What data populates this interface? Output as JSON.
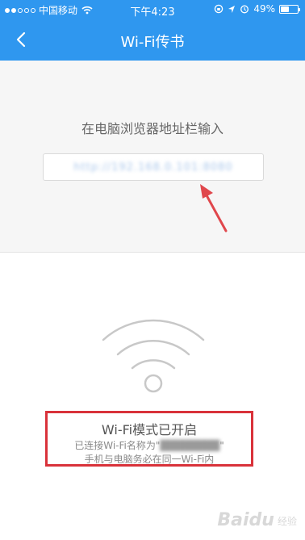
{
  "status_bar": {
    "carrier": "中国移动",
    "time": "下午4:23",
    "battery": "49%",
    "battery_level": 0.49
  },
  "nav": {
    "title": "Wi-Fi传书",
    "back_icon": "chevron-left-icon"
  },
  "instruction": "在电脑浏览器地址栏输入",
  "address": {
    "url": "http://192.168.0.101:8080"
  },
  "wifi_status": {
    "title": "Wi-Fi模式已开启",
    "line1_prefix": "已连接Wi-Fi名称为\"",
    "ssid": "████████",
    "line1_suffix": "\"",
    "line2": "手机与电脑务必在同一Wi-Fi内"
  },
  "watermark": {
    "logo": "Baidu",
    "sub": "经验"
  },
  "colors": {
    "header": "#2f97ef",
    "highlight_border": "#d9323a",
    "arrow": "#e0474c",
    "wifi_icon": "#c8c8c8"
  }
}
